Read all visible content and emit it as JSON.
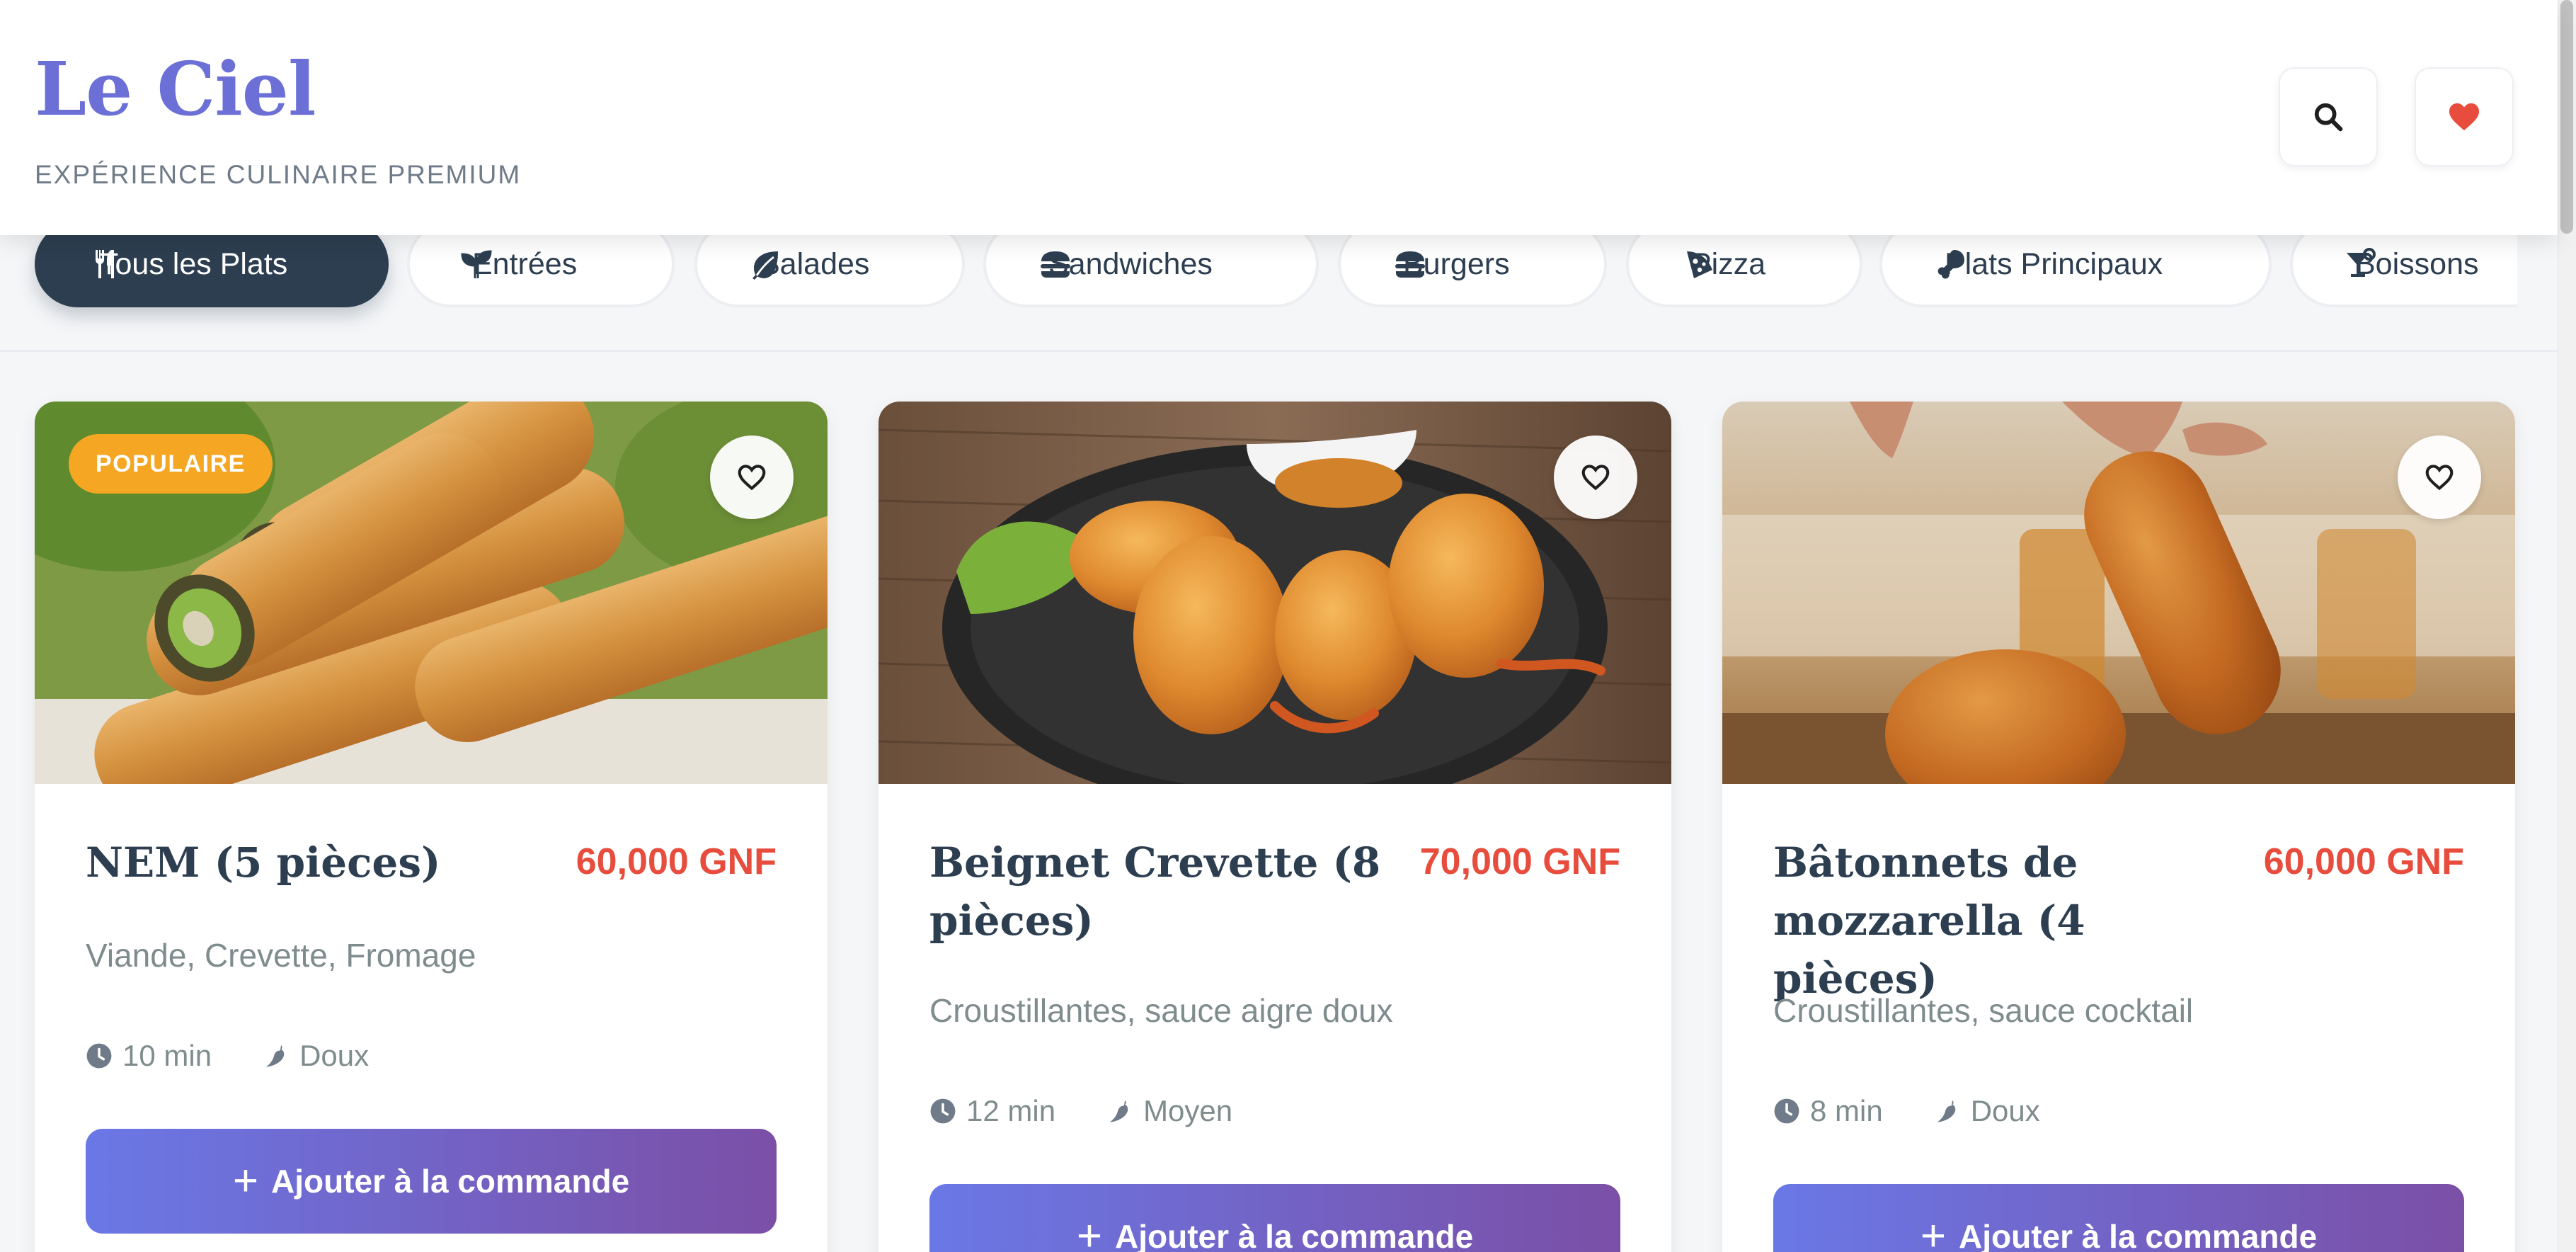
{
  "header": {
    "logo": "Le Ciel",
    "tagline": "EXPÉRIENCE CULINAIRE PREMIUM",
    "search_icon": "search-icon",
    "favorites_icon": "heart-icon"
  },
  "categories": [
    {
      "label": "Tous les Plats",
      "icon": "utensils-icon",
      "active": true
    },
    {
      "label": "Entrées",
      "icon": "seedling-icon",
      "active": false
    },
    {
      "label": "Salades",
      "icon": "leaf-icon",
      "active": false
    },
    {
      "label": "Sandwiches",
      "icon": "sandwich-icon",
      "active": false
    },
    {
      "label": "Burgers",
      "icon": "burger-icon",
      "active": false
    },
    {
      "label": "Pizza",
      "icon": "pizza-icon",
      "active": false
    },
    {
      "label": "Plats Principaux",
      "icon": "drumstick-icon",
      "active": false
    },
    {
      "label": "Boissons",
      "icon": "cocktail-icon",
      "active": false
    }
  ],
  "dishes": [
    {
      "badge": "POPULAIRE",
      "title": "NEM (5 pièces)",
      "price": "60,000 GNF",
      "description": "Viande, Crevette, Fromage",
      "time": "10 min",
      "spice": "Doux",
      "button": "Ajouter à la commande"
    },
    {
      "title": "Beignet Crevette (8 pièces)",
      "price": "70,000 GNF",
      "description": "Croustillantes, sauce aigre doux",
      "time": "12 min",
      "spice": "Moyen",
      "button": "Ajouter à la commande"
    },
    {
      "title": "Bâtonnets de mozzarella (4 pièces)",
      "price": "60,000 GNF",
      "description": "Croustillantes, sauce cocktail",
      "time": "8 min",
      "spice": "Doux",
      "button": "Ajouter à la commande"
    }
  ],
  "colors": {
    "brand": "#6b6fd6",
    "dark": "#2c3e50",
    "price": "#e74c3c",
    "badge": "#f5a623",
    "button_start": "#6a78e6",
    "button_end": "#7b4fa6",
    "favorite": "#e74c3c"
  }
}
